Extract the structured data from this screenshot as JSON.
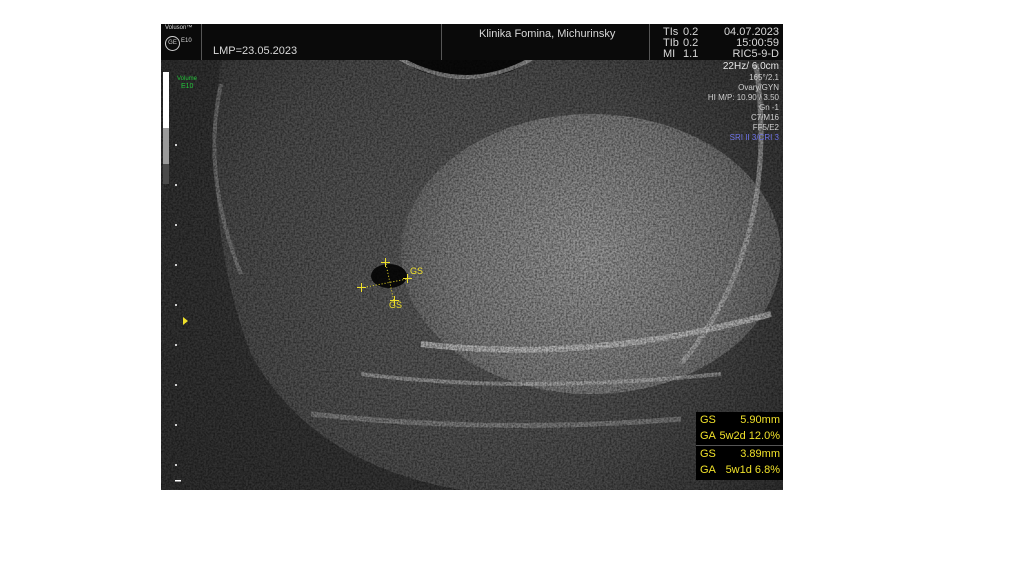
{
  "header": {
    "brand_line1": "Voluson™",
    "brand_line2": "E10",
    "lmp": "LMP=23.05.2023",
    "clinic": "Klinika Fomina, Michurinsky",
    "tis_label": "TIs",
    "tis_value": "0.2",
    "tib_label": "TIb",
    "tib_value": "0.2",
    "mi_label": "MI",
    "mi_value": "1.1",
    "date": "04.07.2023",
    "time": "15:00:59",
    "probe": "RIC5-9-D"
  },
  "left_panel": {
    "volume_label": "Volume",
    "volume_value": "E10"
  },
  "params": [
    "22Hz/ 6.0cm",
    "165°/2.1",
    "Ovary/GYN",
    "HI M/P: 10.90 / 3.50",
    "Gn -1",
    "C7/M16",
    "FF5/E2",
    "SRI II 3/CRI 3"
  ],
  "params_colors": {
    "normal": "#cfcfcf",
    "highlight": "#6f74e8",
    "accent": "#f0e12a",
    "volume": "#23c23a"
  },
  "calipers": {
    "label_1": "GS",
    "label_2": "GS"
  },
  "measurements": [
    {
      "name": "GS",
      "value": "5.90mm"
    },
    {
      "name": "GA",
      "value": "5w2d 12.0%"
    },
    {
      "name": "GS",
      "value": "3.89mm"
    },
    {
      "name": "GA",
      "value": "5w1d 6.8%"
    }
  ]
}
